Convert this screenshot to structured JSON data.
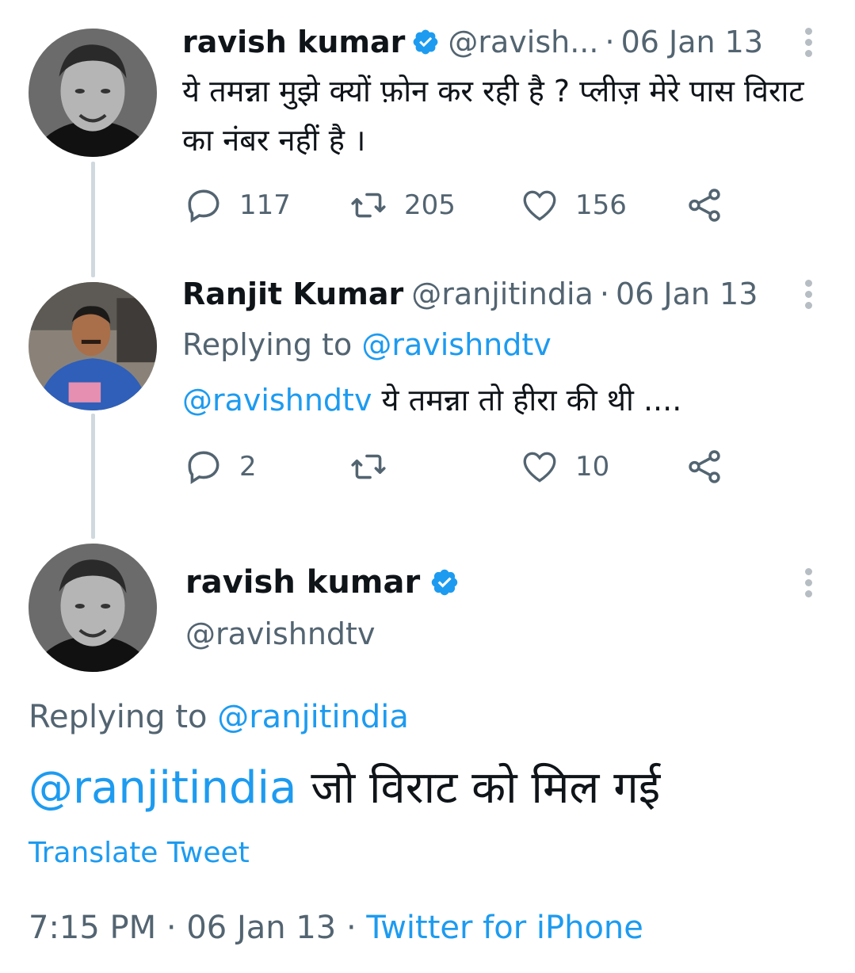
{
  "tweets": [
    {
      "name": "ravish kumar",
      "handle": "@ravish...",
      "separator": "·",
      "date": "06 Jan 13",
      "verified": true,
      "text": "ये तमन्ना मुझे क्यों फ़ोन कर रही है ? प्लीज़ मेरे पास विराट का नंबर नहीं है ।",
      "replies": "117",
      "retweets": "205",
      "likes": "156"
    },
    {
      "name": "Ranjit Kumar",
      "handle": "@ranjitindia",
      "separator": "·",
      "date": "06 Jan 13",
      "replying_prefix": "Replying to",
      "replying_to": "@ravishndtv",
      "mention": "@ravishndtv",
      "text": " ये तमन्ना तो हीरा की थी ....",
      "replies": "2",
      "retweets": "",
      "likes": "10"
    }
  ],
  "main_tweet": {
    "name": "ravish kumar",
    "handle": "@ravishndtv",
    "verified": true,
    "replying_prefix": "Replying to",
    "replying_to": "@ranjitindia",
    "mention": "@ranjitindia",
    "text": " जो विराट को मिल गई",
    "translate_label": "Translate Tweet",
    "time": "7:15 PM",
    "separator": "·",
    "date": "06 Jan 13",
    "source": "Twitter for iPhone"
  },
  "icons": {
    "reply": "reply-icon",
    "retweet": "retweet-icon",
    "like": "like-icon",
    "share": "share-icon",
    "verified": "verified-badge-icon",
    "more": "more-options-icon"
  },
  "colors": {
    "link": "#1d9bf0",
    "secondary_text": "#536471",
    "primary_text": "#0f1419",
    "thread_line": "#cfd9de"
  }
}
